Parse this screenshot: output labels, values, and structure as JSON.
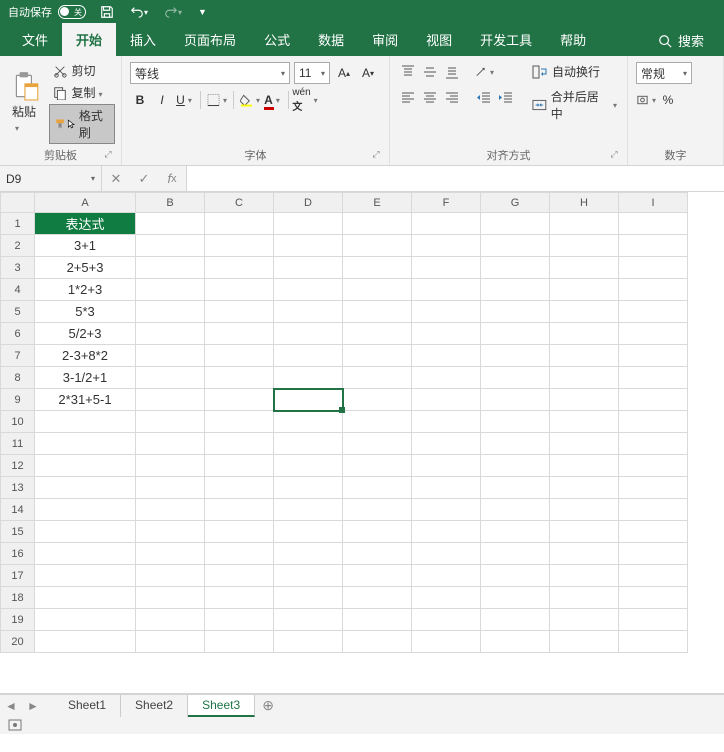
{
  "titlebar": {
    "autosave": "自动保存",
    "toggle": "关"
  },
  "tabs": [
    "文件",
    "开始",
    "插入",
    "页面布局",
    "公式",
    "数据",
    "审阅",
    "视图",
    "开发工具",
    "帮助"
  ],
  "search": "搜索",
  "clipboard": {
    "paste": "粘贴",
    "cut": "剪切",
    "copy": "复制",
    "painter": "格式刷",
    "group": "剪贴板"
  },
  "font": {
    "name": "等线",
    "size": "11",
    "group": "字体"
  },
  "align": {
    "wrap": "自动换行",
    "merge": "合并后居中",
    "group": "对齐方式"
  },
  "number": {
    "format": "常规",
    "group": "数字"
  },
  "namebox": "D9",
  "columns": [
    "A",
    "B",
    "C",
    "D",
    "E",
    "F",
    "G",
    "H",
    "I"
  ],
  "rows": 20,
  "cells": {
    "A1": "表达式",
    "A2": "3+1",
    "A3": "2+5+3",
    "A4": "1*2+3",
    "A5": "5*3",
    "A6": "5/2+3",
    "A7": "2-3+8*2",
    "A8": "3-1/2+1",
    "A9": "2*31+5-1"
  },
  "chart_data": {
    "type": "table",
    "title": "表达式",
    "categories": [
      "A2",
      "A3",
      "A4",
      "A5",
      "A6",
      "A7",
      "A8",
      "A9"
    ],
    "values": [
      "3+1",
      "2+5+3",
      "1*2+3",
      "5*3",
      "5/2+3",
      "2-3+8*2",
      "3-1/2+1",
      "2*31+5-1"
    ]
  },
  "sheets": [
    "Sheet1",
    "Sheet2",
    "Sheet3"
  ],
  "active_sheet": 2,
  "selected_cell": "D9"
}
